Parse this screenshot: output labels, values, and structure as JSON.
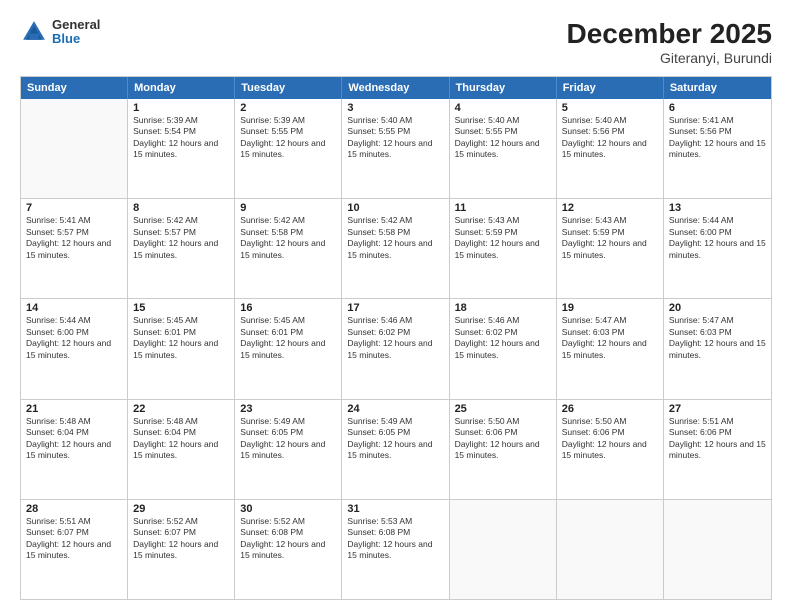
{
  "header": {
    "logo": {
      "line1": "General",
      "line2": "Blue"
    },
    "title": "December 2025",
    "location": "Giteranyi, Burundi"
  },
  "calendar": {
    "days_of_week": [
      "Sunday",
      "Monday",
      "Tuesday",
      "Wednesday",
      "Thursday",
      "Friday",
      "Saturday"
    ],
    "weeks": [
      [
        {
          "day": "",
          "empty": true
        },
        {
          "day": "1",
          "sunrise": "5:39 AM",
          "sunset": "5:54 PM",
          "daylight": "12 hours and 15 minutes."
        },
        {
          "day": "2",
          "sunrise": "5:39 AM",
          "sunset": "5:55 PM",
          "daylight": "12 hours and 15 minutes."
        },
        {
          "day": "3",
          "sunrise": "5:40 AM",
          "sunset": "5:55 PM",
          "daylight": "12 hours and 15 minutes."
        },
        {
          "day": "4",
          "sunrise": "5:40 AM",
          "sunset": "5:55 PM",
          "daylight": "12 hours and 15 minutes."
        },
        {
          "day": "5",
          "sunrise": "5:40 AM",
          "sunset": "5:56 PM",
          "daylight": "12 hours and 15 minutes."
        },
        {
          "day": "6",
          "sunrise": "5:41 AM",
          "sunset": "5:56 PM",
          "daylight": "12 hours and 15 minutes."
        }
      ],
      [
        {
          "day": "7",
          "sunrise": "5:41 AM",
          "sunset": "5:57 PM",
          "daylight": "12 hours and 15 minutes."
        },
        {
          "day": "8",
          "sunrise": "5:42 AM",
          "sunset": "5:57 PM",
          "daylight": "12 hours and 15 minutes."
        },
        {
          "day": "9",
          "sunrise": "5:42 AM",
          "sunset": "5:58 PM",
          "daylight": "12 hours and 15 minutes."
        },
        {
          "day": "10",
          "sunrise": "5:42 AM",
          "sunset": "5:58 PM",
          "daylight": "12 hours and 15 minutes."
        },
        {
          "day": "11",
          "sunrise": "5:43 AM",
          "sunset": "5:59 PM",
          "daylight": "12 hours and 15 minutes."
        },
        {
          "day": "12",
          "sunrise": "5:43 AM",
          "sunset": "5:59 PM",
          "daylight": "12 hours and 15 minutes."
        },
        {
          "day": "13",
          "sunrise": "5:44 AM",
          "sunset": "6:00 PM",
          "daylight": "12 hours and 15 minutes."
        }
      ],
      [
        {
          "day": "14",
          "sunrise": "5:44 AM",
          "sunset": "6:00 PM",
          "daylight": "12 hours and 15 minutes."
        },
        {
          "day": "15",
          "sunrise": "5:45 AM",
          "sunset": "6:01 PM",
          "daylight": "12 hours and 15 minutes."
        },
        {
          "day": "16",
          "sunrise": "5:45 AM",
          "sunset": "6:01 PM",
          "daylight": "12 hours and 15 minutes."
        },
        {
          "day": "17",
          "sunrise": "5:46 AM",
          "sunset": "6:02 PM",
          "daylight": "12 hours and 15 minutes."
        },
        {
          "day": "18",
          "sunrise": "5:46 AM",
          "sunset": "6:02 PM",
          "daylight": "12 hours and 15 minutes."
        },
        {
          "day": "19",
          "sunrise": "5:47 AM",
          "sunset": "6:03 PM",
          "daylight": "12 hours and 15 minutes."
        },
        {
          "day": "20",
          "sunrise": "5:47 AM",
          "sunset": "6:03 PM",
          "daylight": "12 hours and 15 minutes."
        }
      ],
      [
        {
          "day": "21",
          "sunrise": "5:48 AM",
          "sunset": "6:04 PM",
          "daylight": "12 hours and 15 minutes."
        },
        {
          "day": "22",
          "sunrise": "5:48 AM",
          "sunset": "6:04 PM",
          "daylight": "12 hours and 15 minutes."
        },
        {
          "day": "23",
          "sunrise": "5:49 AM",
          "sunset": "6:05 PM",
          "daylight": "12 hours and 15 minutes."
        },
        {
          "day": "24",
          "sunrise": "5:49 AM",
          "sunset": "6:05 PM",
          "daylight": "12 hours and 15 minutes."
        },
        {
          "day": "25",
          "sunrise": "5:50 AM",
          "sunset": "6:06 PM",
          "daylight": "12 hours and 15 minutes."
        },
        {
          "day": "26",
          "sunrise": "5:50 AM",
          "sunset": "6:06 PM",
          "daylight": "12 hours and 15 minutes."
        },
        {
          "day": "27",
          "sunrise": "5:51 AM",
          "sunset": "6:06 PM",
          "daylight": "12 hours and 15 minutes."
        }
      ],
      [
        {
          "day": "28",
          "sunrise": "5:51 AM",
          "sunset": "6:07 PM",
          "daylight": "12 hours and 15 minutes."
        },
        {
          "day": "29",
          "sunrise": "5:52 AM",
          "sunset": "6:07 PM",
          "daylight": "12 hours and 15 minutes."
        },
        {
          "day": "30",
          "sunrise": "5:52 AM",
          "sunset": "6:08 PM",
          "daylight": "12 hours and 15 minutes."
        },
        {
          "day": "31",
          "sunrise": "5:53 AM",
          "sunset": "6:08 PM",
          "daylight": "12 hours and 15 minutes."
        },
        {
          "day": "",
          "empty": true
        },
        {
          "day": "",
          "empty": true
        },
        {
          "day": "",
          "empty": true
        }
      ]
    ]
  }
}
